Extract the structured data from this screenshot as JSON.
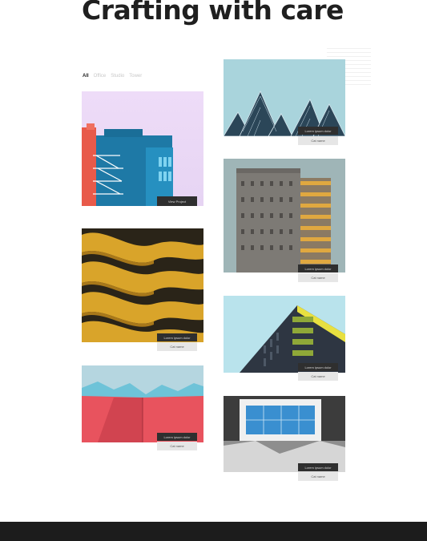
{
  "header": {
    "title": "Crafting with care"
  },
  "filters": [
    {
      "label": "All",
      "active": true
    },
    {
      "label": "Office",
      "active": false
    },
    {
      "label": "Studio",
      "active": false
    },
    {
      "label": "Tower",
      "active": false
    }
  ],
  "cards": [
    {
      "overlay": "View Project",
      "category": ""
    },
    {
      "overlay": "Lorem ipsum dolor",
      "category": "Cat name"
    },
    {
      "overlay": "Lorem ipsum dolor",
      "category": "Cat name"
    },
    {
      "overlay": "Lorem ipsum dolor",
      "category": "Cat name"
    },
    {
      "overlay": "Lorem ipsum dolor",
      "category": "Cat name"
    },
    {
      "overlay": "Lorem ipsum dolor",
      "category": "Cat name"
    },
    {
      "overlay": "Lorem ipsum dolor",
      "category": "Cat name"
    }
  ]
}
